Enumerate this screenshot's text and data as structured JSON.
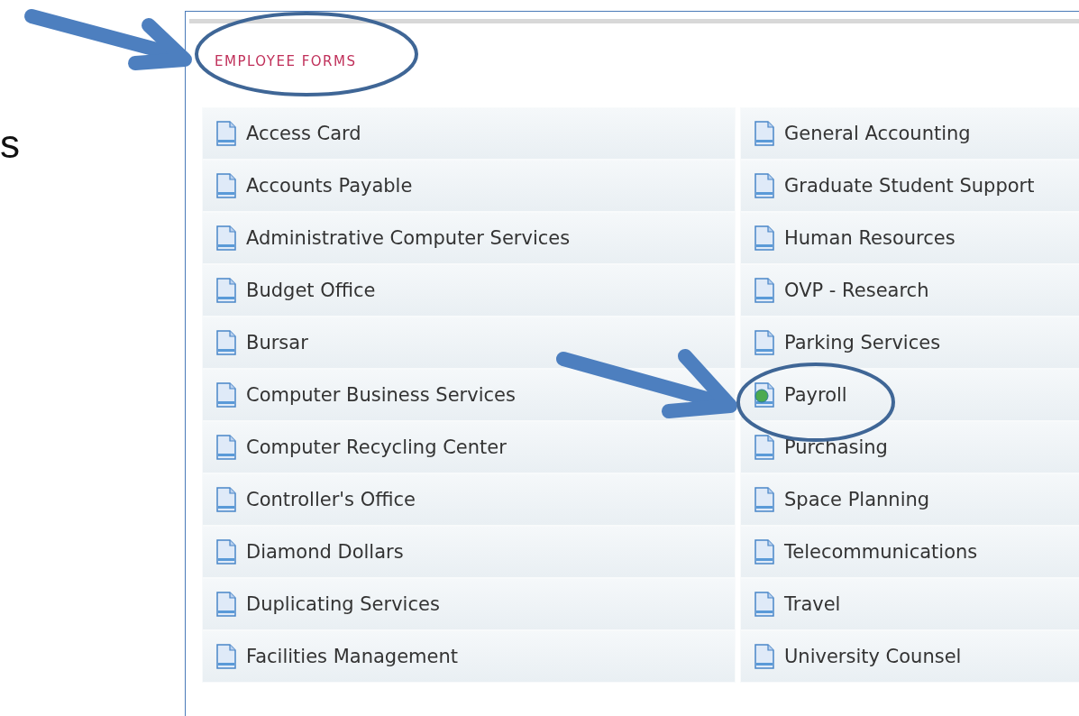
{
  "side_text": "s",
  "section": {
    "title": "EMPLOYEE FORMS"
  },
  "columns": [
    [
      {
        "label": "Access Card",
        "kind": "document"
      },
      {
        "label": "Accounts Payable",
        "kind": "document"
      },
      {
        "label": "Administrative Computer Services",
        "kind": "document"
      },
      {
        "label": "Budget Office",
        "kind": "document"
      },
      {
        "label": "Bursar",
        "kind": "document"
      },
      {
        "label": "Computer Business Services",
        "kind": "document"
      },
      {
        "label": "Computer Recycling Center",
        "kind": "document"
      },
      {
        "label": "Controller's Office",
        "kind": "document"
      },
      {
        "label": "Diamond Dollars",
        "kind": "document"
      },
      {
        "label": "Duplicating Services",
        "kind": "document"
      },
      {
        "label": "Facilities Management",
        "kind": "document"
      }
    ],
    [
      {
        "label": "General Accounting",
        "kind": "document"
      },
      {
        "label": "Graduate Student Support",
        "kind": "document"
      },
      {
        "label": "Human Resources",
        "kind": "document"
      },
      {
        "label": "OVP - Research",
        "kind": "document"
      },
      {
        "label": "Parking Services",
        "kind": "document"
      },
      {
        "label": "Payroll",
        "kind": "web"
      },
      {
        "label": "Purchasing",
        "kind": "document"
      },
      {
        "label": "Space Planning",
        "kind": "document"
      },
      {
        "label": "Telecommunications",
        "kind": "document"
      },
      {
        "label": "Travel",
        "kind": "document"
      },
      {
        "label": "University Counsel",
        "kind": "document"
      }
    ]
  ]
}
